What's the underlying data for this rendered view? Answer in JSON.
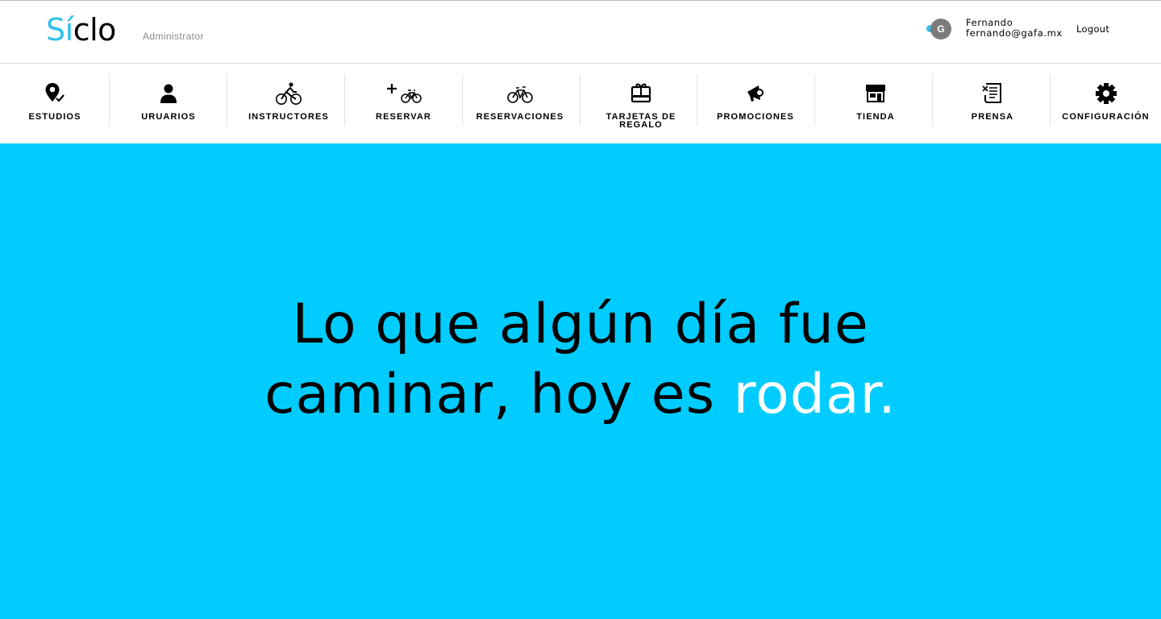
{
  "header": {
    "logo_accent": "Sí",
    "logo_rest": "clo",
    "role": "Administrator",
    "user": {
      "avatar_initial": "G",
      "name": "Fernando",
      "email": "fernando@gafa.mx"
    },
    "logout_label": "Logout"
  },
  "nav": {
    "items": [
      {
        "label": "ESTUDIOS",
        "icon": "location-pin-check-icon"
      },
      {
        "label": "URUARIOS",
        "icon": "user-icon"
      },
      {
        "label": "INSTRUCTORES",
        "icon": "cyclist-icon"
      },
      {
        "label": "RESERVAR",
        "icon": "plus-bike-icon"
      },
      {
        "label": "RESERVACIONES",
        "icon": "bike-icon"
      },
      {
        "label": "TARJETAS DE REGALO",
        "icon": "gift-card-icon"
      },
      {
        "label": "PROMOCIONES",
        "icon": "megaphone-icon"
      },
      {
        "label": "TIENDA",
        "icon": "store-icon"
      },
      {
        "label": "PRENSA",
        "icon": "newspaper-icon"
      },
      {
        "label": "CONFIGURACIÓN",
        "icon": "gear-icon"
      }
    ]
  },
  "hero": {
    "line1": "Lo que algún día fue",
    "line2_dark": "caminar, hoy es ",
    "line2_highlight": "rodar."
  },
  "colors": {
    "brand_accent": "#34c0ec",
    "hero_background": "#00ccff",
    "hero_highlight": "#ffffff"
  }
}
